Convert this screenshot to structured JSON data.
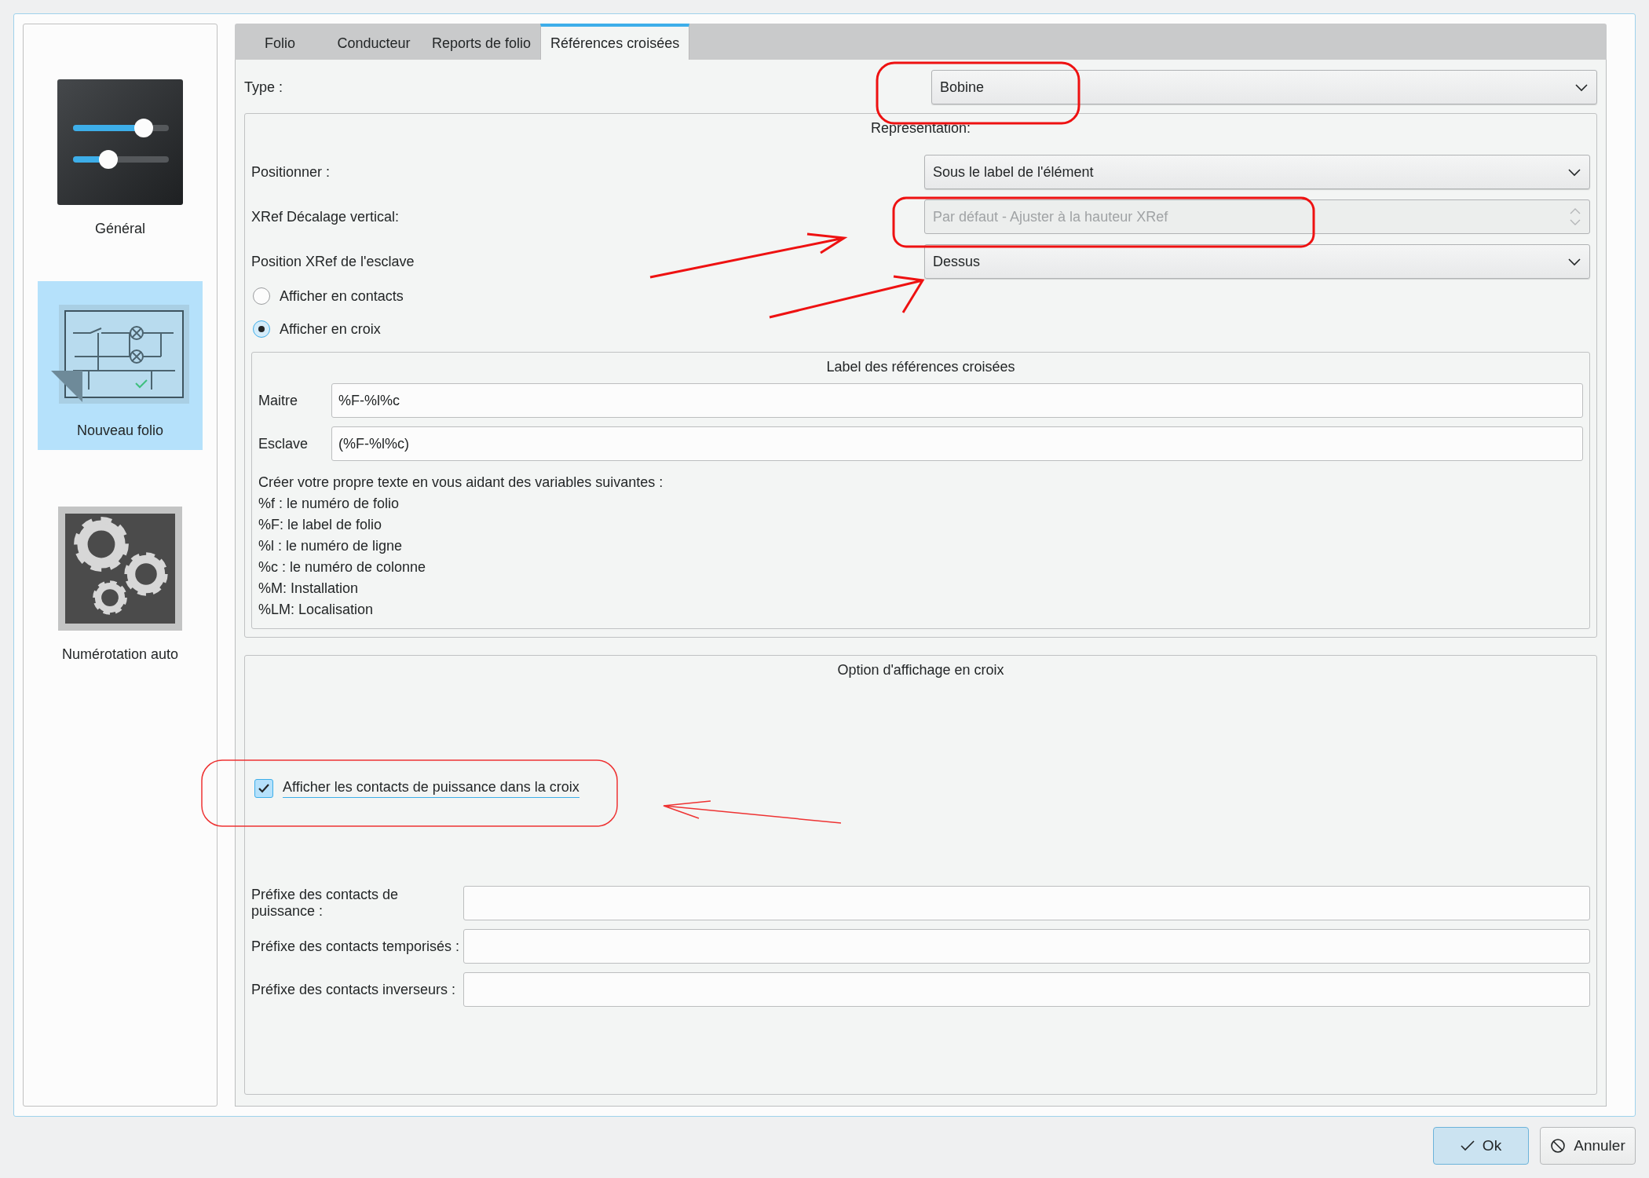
{
  "sidebar": {
    "items": [
      {
        "label": "Général",
        "selected": false,
        "kind": "sliders"
      },
      {
        "label": "Nouveau folio",
        "selected": true,
        "kind": "schematic"
      },
      {
        "label": "Numérotation auto",
        "selected": false,
        "kind": "gears"
      }
    ]
  },
  "tabs": [
    {
      "label": "Folio",
      "selected": false
    },
    {
      "label": "Conducteur",
      "selected": false
    },
    {
      "label": "Reports de folio",
      "selected": false
    },
    {
      "label": "Références croisées",
      "selected": true
    }
  ],
  "type": {
    "label": "Type :",
    "value": "Bobine"
  },
  "representation": {
    "title": "Représentation:",
    "rows": [
      {
        "kind": "combo",
        "label": "Positionner :",
        "value": "Sous le label de l'élément",
        "disabled": false
      },
      {
        "kind": "spin",
        "label": "XRef Décalage vertical:",
        "value": "Par défaut - Ajuster à la hauteur XRef",
        "disabled": true
      },
      {
        "kind": "combo",
        "label": "Position XRef de l'esclave",
        "value": "Dessus",
        "disabled": false
      }
    ],
    "radios": [
      {
        "label": "Afficher en contacts",
        "selected": false
      },
      {
        "label": "Afficher en croix",
        "selected": true
      }
    ],
    "label_group": {
      "title": "Label des références croisées",
      "fields": [
        {
          "label": "Maitre",
          "value": "%F-%l%c"
        },
        {
          "label": "Esclave",
          "value": "(%F-%l%c)"
        }
      ],
      "help": [
        "Créer votre propre texte en vous aidant des variables suivantes :",
        "%f : le numéro de folio",
        "%F: le label de folio",
        "%l : le numéro de ligne",
        "%c : le numéro de colonne",
        "%M: Installation",
        "%LM: Localisation"
      ]
    }
  },
  "cross_options": {
    "title": "Option d'affichage en croix",
    "checkbox": {
      "label": "Afficher les contacts de puissance dans la croix",
      "checked": true
    },
    "prefixes": [
      {
        "label": "Préfixe des contacts de puissance :"
      },
      {
        "label": "Préfixe des contacts temporisés :"
      },
      {
        "label": "Préfixe des contacts inverseurs :"
      }
    ]
  },
  "buttons": [
    {
      "label": "Ok",
      "kind": "ok"
    },
    {
      "label": "Annuler",
      "kind": "cancel"
    }
  ]
}
